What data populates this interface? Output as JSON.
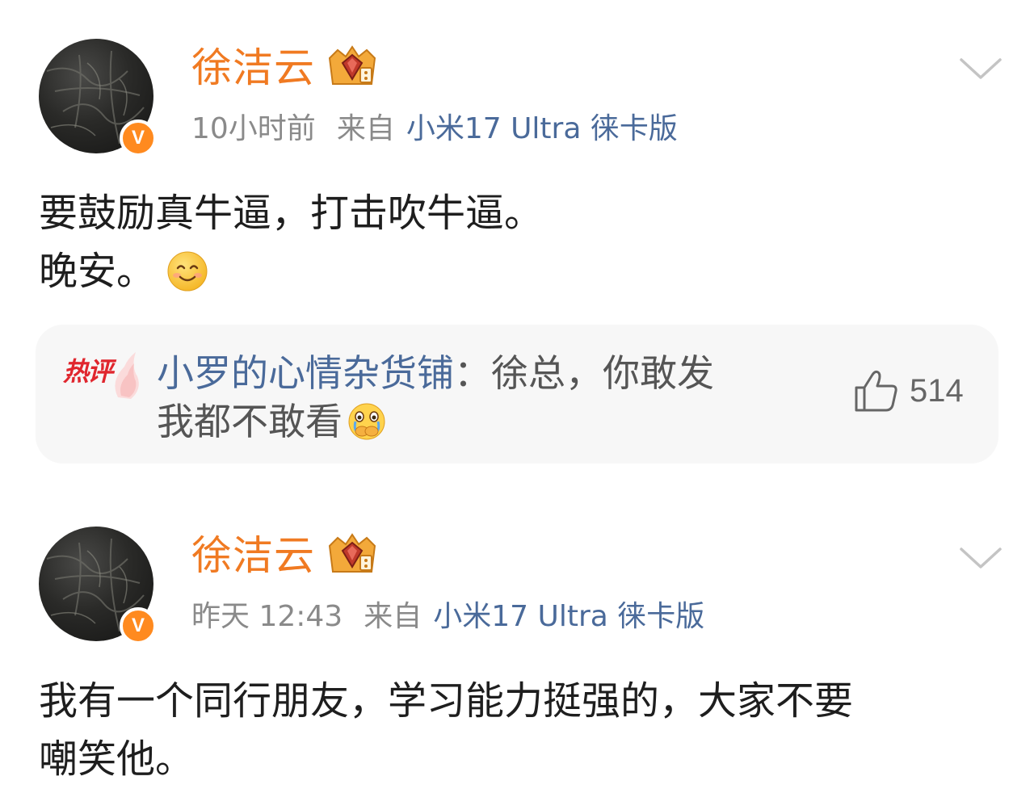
{
  "posts": [
    {
      "username": "徐洁云",
      "verified_mark": "V",
      "time": "10小时前",
      "from_label": "来自",
      "device": "小米17 Ultra 徕卡版",
      "content_line1": "要鼓励真牛逼，打击吹牛逼。",
      "content_line2": "晚安。",
      "content_emoji": "smile-emoji",
      "hot_comment": {
        "badge": "热评",
        "user": "小罗的心情杂货铺",
        "separator": "：",
        "text_line1": "徐总，你敢发",
        "text_line2": "我都不敢看",
        "emoji": "cry-cover-mouth-emoji",
        "like_icon": "thumbs-up-icon",
        "like_count": "514"
      }
    },
    {
      "username": "徐洁云",
      "verified_mark": "V",
      "time": "昨天 12:43",
      "from_label": "来自",
      "device": "小米17 Ultra 徕卡版",
      "content_line1": "我有一个同行朋友，学习能力挺强的，大家不要",
      "content_line2": "嘲笑他。"
    }
  ],
  "colors": {
    "username": "#f07a22",
    "verified_badge": "#ff8a1f",
    "link_blue": "#4a6a9a",
    "meta_gray": "#8a8a8a",
    "hot_red": "#e0262e",
    "comment_bg": "#f7f7f7"
  },
  "icons": {
    "member_badge": "crown-gem-badge-icon",
    "more": "chevron-down-icon"
  }
}
